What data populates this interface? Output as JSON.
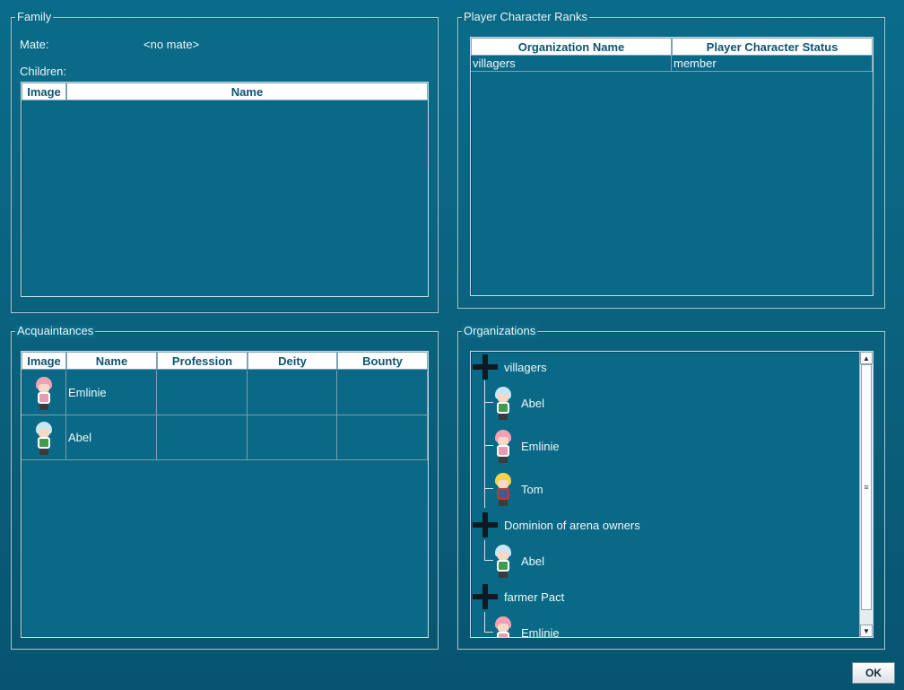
{
  "family": {
    "title": "Family",
    "mate_label": "Mate:",
    "mate_value": "<no mate>",
    "children_label": "Children:",
    "columns": [
      "Image",
      "Name"
    ]
  },
  "ranks": {
    "title": "Player Character Ranks",
    "columns": [
      "Organization Name",
      "Player Character Status"
    ],
    "rows": [
      {
        "org": "villagers",
        "status": "member"
      }
    ]
  },
  "acquaintances": {
    "title": "Acquaintances",
    "columns": [
      "Image",
      "Name",
      "Profession",
      "Deity",
      "Bounty"
    ],
    "rows": [
      {
        "sprite": "pink-haired-girl-sprite",
        "name": "Emlinie",
        "profession": "",
        "deity": "",
        "bounty": ""
      },
      {
        "sprite": "blue-haired-boy-sprite",
        "name": "Abel",
        "profession": "",
        "deity": "",
        "bounty": ""
      }
    ]
  },
  "organizations": {
    "title": "Organizations",
    "groups": [
      {
        "icon": "iron-cross-icon",
        "name": "villagers",
        "members": [
          {
            "sprite": "blue-haired-boy-sprite",
            "name": "Abel"
          },
          {
            "sprite": "pink-haired-girl-sprite",
            "name": "Emlinie"
          },
          {
            "sprite": "blond-boy-sprite",
            "name": "Tom"
          }
        ]
      },
      {
        "icon": "iron-cross-icon",
        "name": "Dominion of arena owners",
        "members": [
          {
            "sprite": "blue-haired-boy-sprite",
            "name": "Abel"
          }
        ]
      },
      {
        "icon": "iron-cross-icon",
        "name": "farmer Pact",
        "members": [
          {
            "sprite": "pink-haired-girl-sprite",
            "name": "Emlinie"
          }
        ]
      }
    ]
  },
  "ok_label": "OK"
}
